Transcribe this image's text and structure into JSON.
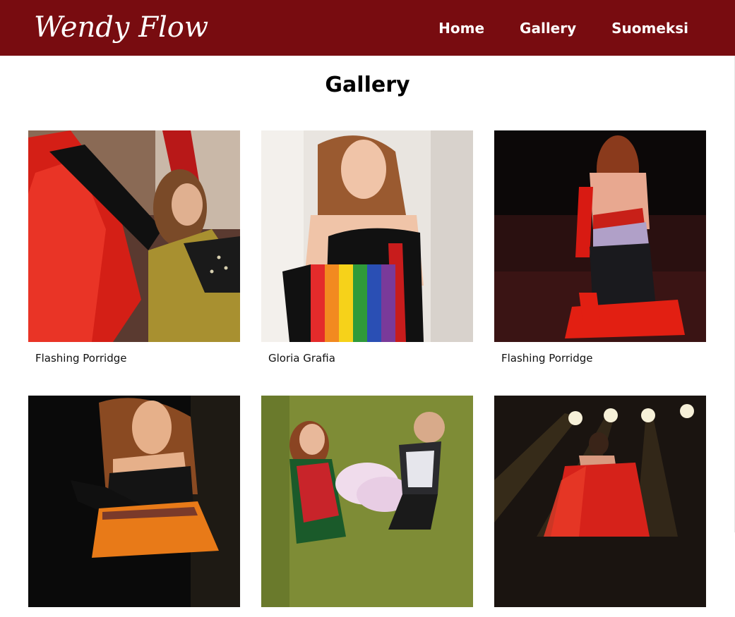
{
  "header": {
    "logo_text": "Wendy Flow",
    "nav": [
      {
        "label": "Home"
      },
      {
        "label": "Gallery"
      },
      {
        "label": "Suomeksi"
      }
    ]
  },
  "main": {
    "title": "Gallery",
    "items": [
      {
        "caption": "Flashing Porridge"
      },
      {
        "caption": "Gloria Grafia"
      },
      {
        "caption": "Flashing Porridge"
      },
      {
        "caption": ""
      },
      {
        "caption": ""
      },
      {
        "caption": ""
      }
    ]
  },
  "colors": {
    "header_bg": "#780c10",
    "nav_text": "#ffffff"
  }
}
